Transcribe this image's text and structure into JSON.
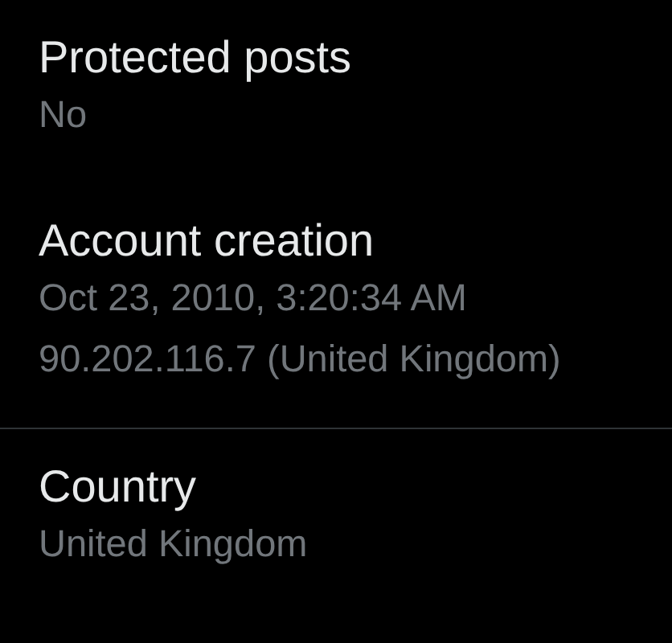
{
  "sections": [
    {
      "title": "Protected posts",
      "lines": [
        "No"
      ],
      "divider_before": false
    },
    {
      "title": "Account creation",
      "lines": [
        "Oct 23, 2010, 3:20:34 AM",
        "90.202.116.7 (United Kingdom)"
      ],
      "divider_before": false
    },
    {
      "title": "Country",
      "lines": [
        "United Kingdom"
      ],
      "divider_before": true
    }
  ]
}
